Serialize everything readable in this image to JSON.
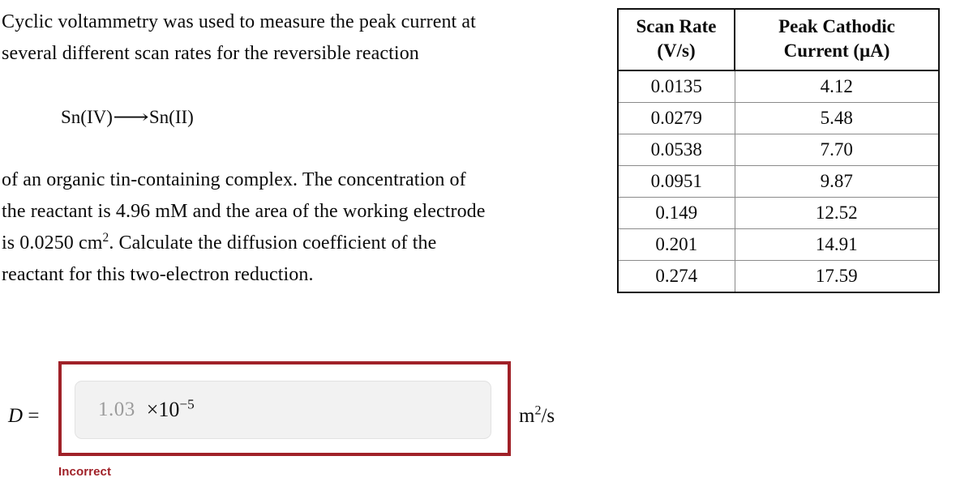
{
  "problem": {
    "lines": [
      "Cyclic voltammetry was used to measure the peak current at",
      "several different scan rates for the reversible reaction"
    ],
    "equation": {
      "reactant": "Sn(IV)",
      "arrow": "⟶",
      "product": "Sn(II)"
    },
    "lines2": [
      "of an organic tin-containing complex. The concentration of",
      "the reactant is 4.96 mM and the area of the working electrode"
    ],
    "line_area_pre": "is 0.0250 cm",
    "line_area_sup": "2",
    "line_area_post": ". Calculate the diffusion coefficient of the",
    "line_last": "reactant for this two-electron reduction."
  },
  "table": {
    "headers": {
      "scan_rate_line1": "Scan Rate",
      "scan_rate_line2": "(V/s)",
      "current_line1": "Peak Cathodic",
      "current_line2": "Current (μA)"
    },
    "rows": [
      {
        "scan_rate": "0.0135",
        "current": "4.12"
      },
      {
        "scan_rate": "0.0279",
        "current": "5.48"
      },
      {
        "scan_rate": "0.0538",
        "current": "7.70"
      },
      {
        "scan_rate": "0.0951",
        "current": "9.87"
      },
      {
        "scan_rate": "0.149",
        "current": "12.52"
      },
      {
        "scan_rate": "0.201",
        "current": "14.91"
      },
      {
        "scan_rate": "0.274",
        "current": "17.59"
      }
    ]
  },
  "answer": {
    "label": "D =",
    "label_var": "D",
    "label_eq": " =",
    "value": "1.03",
    "placeholder": "1.03",
    "exponent_base": "×10",
    "exponent_power": "−5",
    "units_base": "m",
    "units_sup": "2",
    "units_rest": "/s",
    "feedback": "Incorrect"
  },
  "colors": {
    "error_red": "#a02128",
    "input_fill": "#f2f2f2",
    "value_grey": "#9b9b9b",
    "table_border": "#111111",
    "table_inner_border": "#8a8a8a",
    "text": "#0b0b0b"
  },
  "chart_data": {
    "type": "table",
    "title": "Peak cathodic current vs. scan rate",
    "xlabel": "Scan Rate (V/s)",
    "ylabel": "Peak Cathodic Current (μA)",
    "categories": [
      "0.0135",
      "0.0279",
      "0.0538",
      "0.0951",
      "0.149",
      "0.201",
      "0.274"
    ],
    "x": [
      0.0135,
      0.0279,
      0.0538,
      0.0951,
      0.149,
      0.201,
      0.274
    ],
    "series": [
      {
        "name": "Peak Cathodic Current (μA)",
        "values": [
          4.12,
          5.48,
          7.7,
          9.87,
          12.52,
          14.91,
          17.59
        ]
      }
    ]
  }
}
